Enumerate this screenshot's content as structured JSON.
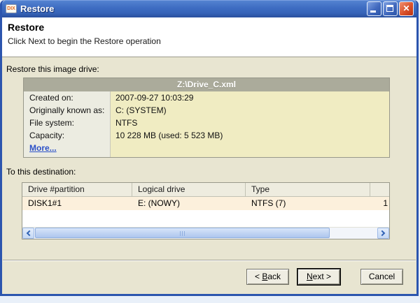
{
  "window": {
    "title": "Restore",
    "icon_text": "DIX"
  },
  "titlebar": {
    "close_glyph": "✕"
  },
  "header": {
    "title": "Restore",
    "subtitle": "Click Next to begin the Restore operation"
  },
  "source_section": {
    "label": "Restore this image drive:",
    "table": {
      "header": "Z:\\Drive_C.xml",
      "rows": [
        {
          "label": "Created on:",
          "value": "2007-09-27 10:03:29"
        },
        {
          "label": "Originally known as:",
          "value": "C: (SYSTEM)"
        },
        {
          "label": "File system:",
          "value": "NTFS"
        },
        {
          "label": "Capacity:",
          "value": "10 228 MB (used: 5 523 MB)"
        }
      ],
      "more_link": "More..."
    }
  },
  "destination_section": {
    "label": "To this destination:",
    "table": {
      "columns": [
        "Drive #partition",
        "Logical drive",
        "Type",
        ""
      ],
      "rows": [
        {
          "drive": "DISK1#1",
          "logical": "E: (NOWY)",
          "type": "NTFS (7)",
          "size": "1"
        }
      ]
    }
  },
  "footer": {
    "back": {
      "pre": "< ",
      "key": "B",
      "post": "ack"
    },
    "next": {
      "pre": "",
      "key": "N",
      "post": "ext >"
    },
    "cancel": {
      "label": "Cancel"
    }
  },
  "colors": {
    "titlebar_blue": "#3E6DC2",
    "window_border": "#2C55AE",
    "body_beige": "#E8E5D1",
    "table_header_gray": "#ABAB9B",
    "value_yellow": "#F0ECC2",
    "row_peach": "#FCF0DC",
    "link_blue": "#2B50C8",
    "close_red": "#D9512B"
  }
}
